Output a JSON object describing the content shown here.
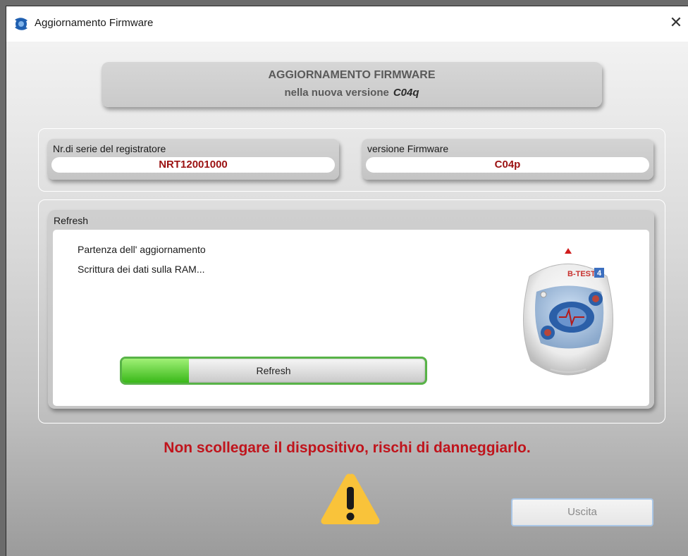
{
  "window": {
    "title": "Aggiornamento Firmware",
    "close_symbol": "✕"
  },
  "header": {
    "title": "AGGIORNAMENTO FIRMWARE",
    "subtitle_prefix": "nella nuova versione",
    "new_version": "C04q"
  },
  "serial": {
    "label": "Nr.di serie del registratore",
    "value": "NRT12001000"
  },
  "firmware": {
    "label": "versione Firmware",
    "value": "C04p"
  },
  "refresh": {
    "label": "Refresh",
    "log": [
      "Partenza dell' aggiornamento",
      "Scrittura dei dati sulla RAM..."
    ],
    "progress_label": "Refresh",
    "progress_fraction": 0.22,
    "device_brand": "B-TEST",
    "device_model": "4"
  },
  "warning": {
    "message": "Non scollegare il dispositivo, rischi di danneggiarlo."
  },
  "buttons": {
    "exit": "Uscita"
  },
  "colors": {
    "accent_red": "#c0141c",
    "value_red": "#9b1111",
    "progress_green": "#58b347",
    "button_border": "#a9c6e6",
    "warning_yellow": "#f9c33a"
  }
}
